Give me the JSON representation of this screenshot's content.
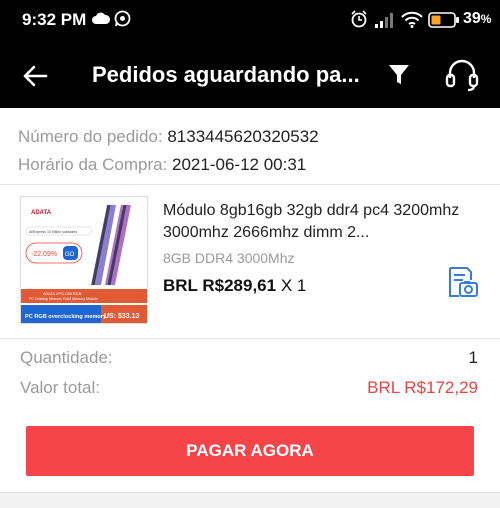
{
  "status_bar": {
    "time": "9:32 PM",
    "battery": "39",
    "icons": [
      "cloud-icon",
      "whatsapp-icon",
      "alarm-icon",
      "signal-icon",
      "wifi-icon",
      "battery-icon"
    ]
  },
  "header": {
    "title": "Pedidos aguardando pa...",
    "back_icon": "arrow-left-icon",
    "filter_icon": "filter-icon",
    "support_icon": "headset-icon"
  },
  "order": {
    "number_label": "Número do pedido:",
    "number_value": "8133445620320532",
    "date_label": "Horário da Compra:",
    "date_value": "2021-06-12 00:31"
  },
  "product": {
    "title": "Módulo 8gb16gb 32gb ddr4 pc4 3200mhz 3000mhz 2666mhz dimm 2...",
    "variant": "8GB DDR4 3000Mhz",
    "price": "BRL R$289,61",
    "quantity_text": "X 1",
    "thumb": {
      "brand": "ADATA",
      "promo": "AliExpress 10 billion subsidies",
      "discount": "-22.09%",
      "go": "GO",
      "model_line1": "ADATA XPG D50 RGB",
      "model_line2": "PC Desktop Memory RAM Memory Module",
      "footer": "PC RGB overclocking memory",
      "footer_price": "US: $33.13"
    }
  },
  "summary": {
    "qty_label": "Quantidade:",
    "qty_value": "1",
    "total_label": "Valor total:",
    "total_value": "BRL R$172,29"
  },
  "actions": {
    "pay_now": "PAGAR AGORA"
  },
  "colors": {
    "accent": "#f5444a",
    "total": "#e64545",
    "receipt_icon": "#3a7bd5"
  }
}
